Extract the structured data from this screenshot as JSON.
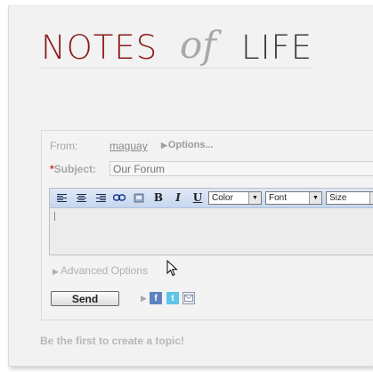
{
  "logo": {
    "word1": "NOTES",
    "word2": "of",
    "word3": "LIFE",
    "color_primary": "#8c1c1c",
    "color_secondary": "#a9a9a9",
    "color_dark": "#3e3e3e"
  },
  "form": {
    "from_label": "From:",
    "from_user": "maguay",
    "options_label": "Options...",
    "subject_required_mark": "*",
    "subject_label": "Subject:",
    "subject_placeholder": "Our Forum",
    "toolbar": {
      "color_select": "Color",
      "font_select": "Font",
      "size_select": "Size",
      "bold": "B",
      "italic": "I",
      "underline": "U"
    },
    "advanced_options": "Advanced Options",
    "send_label": "Send"
  },
  "social": {
    "facebook": "f",
    "twitter": "t"
  },
  "footer": {
    "message": "Be the first to create a topic!"
  }
}
